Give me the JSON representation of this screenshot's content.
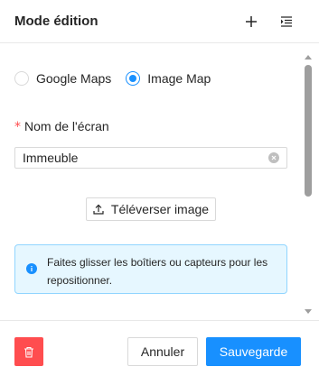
{
  "header": {
    "title": "Mode édition",
    "add_icon": "plus-icon",
    "indent_icon": "indent-icon"
  },
  "form": {
    "map_type_options": [
      {
        "label": "Google Maps",
        "checked": false
      },
      {
        "label": "Image Map",
        "checked": true
      }
    ],
    "screen_name_label": "Nom de l'écran",
    "required_mark": "*",
    "screen_name_value": "Immeuble",
    "upload_label": "Téléverser image",
    "info_text": "Faites glisser les boîtiers ou capteurs pour les repositionner."
  },
  "footer": {
    "cancel_label": "Annuler",
    "save_label": "Sauvegarde",
    "delete_icon": "trash-icon"
  },
  "colors": {
    "primary": "#1890ff",
    "danger": "#ff4d4f",
    "info_bg": "#e6f7ff",
    "info_border": "#91d5ff"
  }
}
